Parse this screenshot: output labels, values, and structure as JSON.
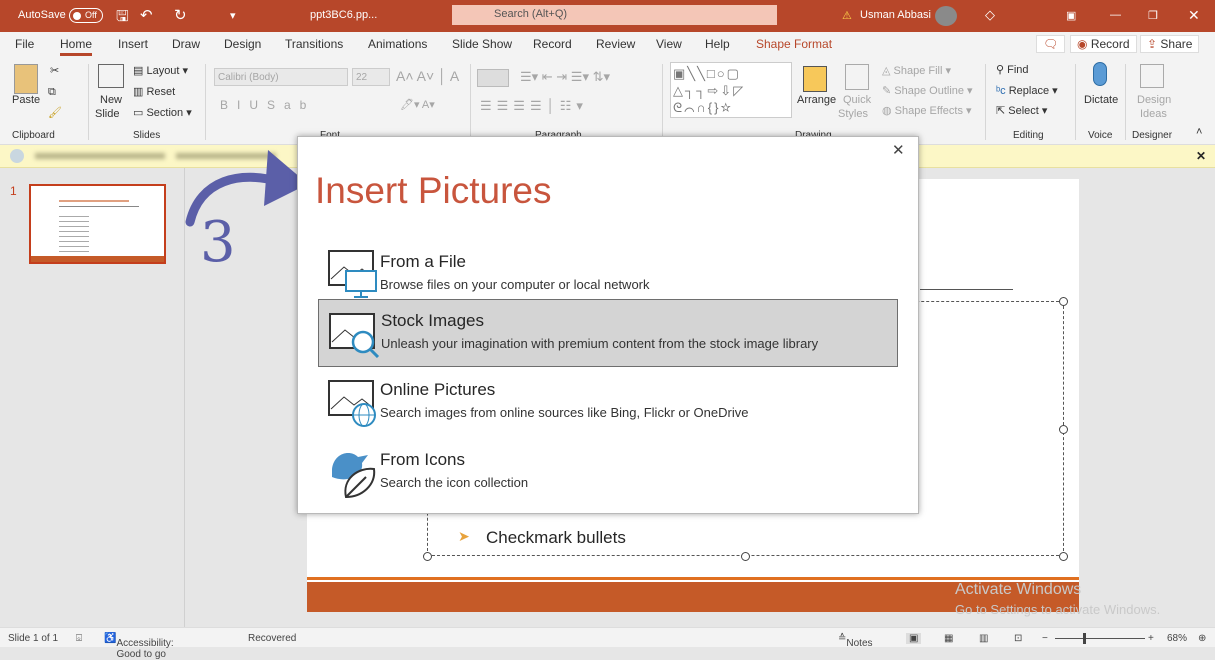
{
  "titlebar": {
    "autosave": "AutoSave",
    "autosave_state": "Off",
    "filename": "ppt3BC6.pp...",
    "search_placeholder": "Search (Alt+Q)",
    "user": "Usman Abbasi"
  },
  "tabs": [
    "File",
    "Home",
    "Insert",
    "Draw",
    "Design",
    "Transitions",
    "Animations",
    "Slide Show",
    "Record",
    "Review",
    "View",
    "Help",
    "Shape Format"
  ],
  "tab_actions": {
    "record": "Record",
    "share": "Share"
  },
  "ribbon": {
    "clipboard": {
      "paste": "Paste",
      "group": "Clipboard"
    },
    "slides": {
      "new_slide": "New",
      "new_slide2": "Slide",
      "layout": "Layout",
      "reset": "Reset",
      "section": "Section",
      "group": "Slides"
    },
    "font": {
      "name": "Calibri (Body)",
      "size": "22",
      "group": "Font"
    },
    "paragraph": {
      "group": "Paragraph"
    },
    "drawing": {
      "arrange": "Arrange",
      "quick_styles": "Quick",
      "quick_styles2": "Styles",
      "shape_fill": "Shape Fill",
      "shape_outline": "Shape Outline",
      "shape_effects": "Shape Effects",
      "group": "Drawing"
    },
    "editing": {
      "find": "Find",
      "replace": "Replace",
      "select": "Select",
      "group": "Editing"
    },
    "voice": {
      "dictate": "Dictate",
      "group": "Voice"
    },
    "designer": {
      "design_ideas": "Design",
      "design_ideas2": "Ideas",
      "group": "Designer"
    }
  },
  "thumbnail": {
    "number": "1"
  },
  "annotation": {
    "step": "3",
    "color": "#5b5fa8"
  },
  "dialog": {
    "title": "Insert Pictures",
    "options": [
      {
        "title": "From a File",
        "subtitle": "Browse files on your computer or local network"
      },
      {
        "title": "Stock Images",
        "subtitle": "Unleash your imagination with premium content from the stock image library",
        "selected": true
      },
      {
        "title": "Online Pictures",
        "subtitle": "Search images from online sources like Bing, Flickr or OneDrive"
      },
      {
        "title": "From Icons",
        "subtitle": "Search the icon collection"
      }
    ]
  },
  "slide": {
    "bullet": "Checkmark bullets",
    "accent": "#c55a28"
  },
  "watermark": {
    "line1": "Activate Windows",
    "line2": "Go to Settings to activate Windows."
  },
  "status": {
    "slide": "Slide 1 of 1",
    "accessibility": "Accessibility: Good to go",
    "recovered": "Recovered",
    "notes": "Notes",
    "zoom": "68%"
  }
}
